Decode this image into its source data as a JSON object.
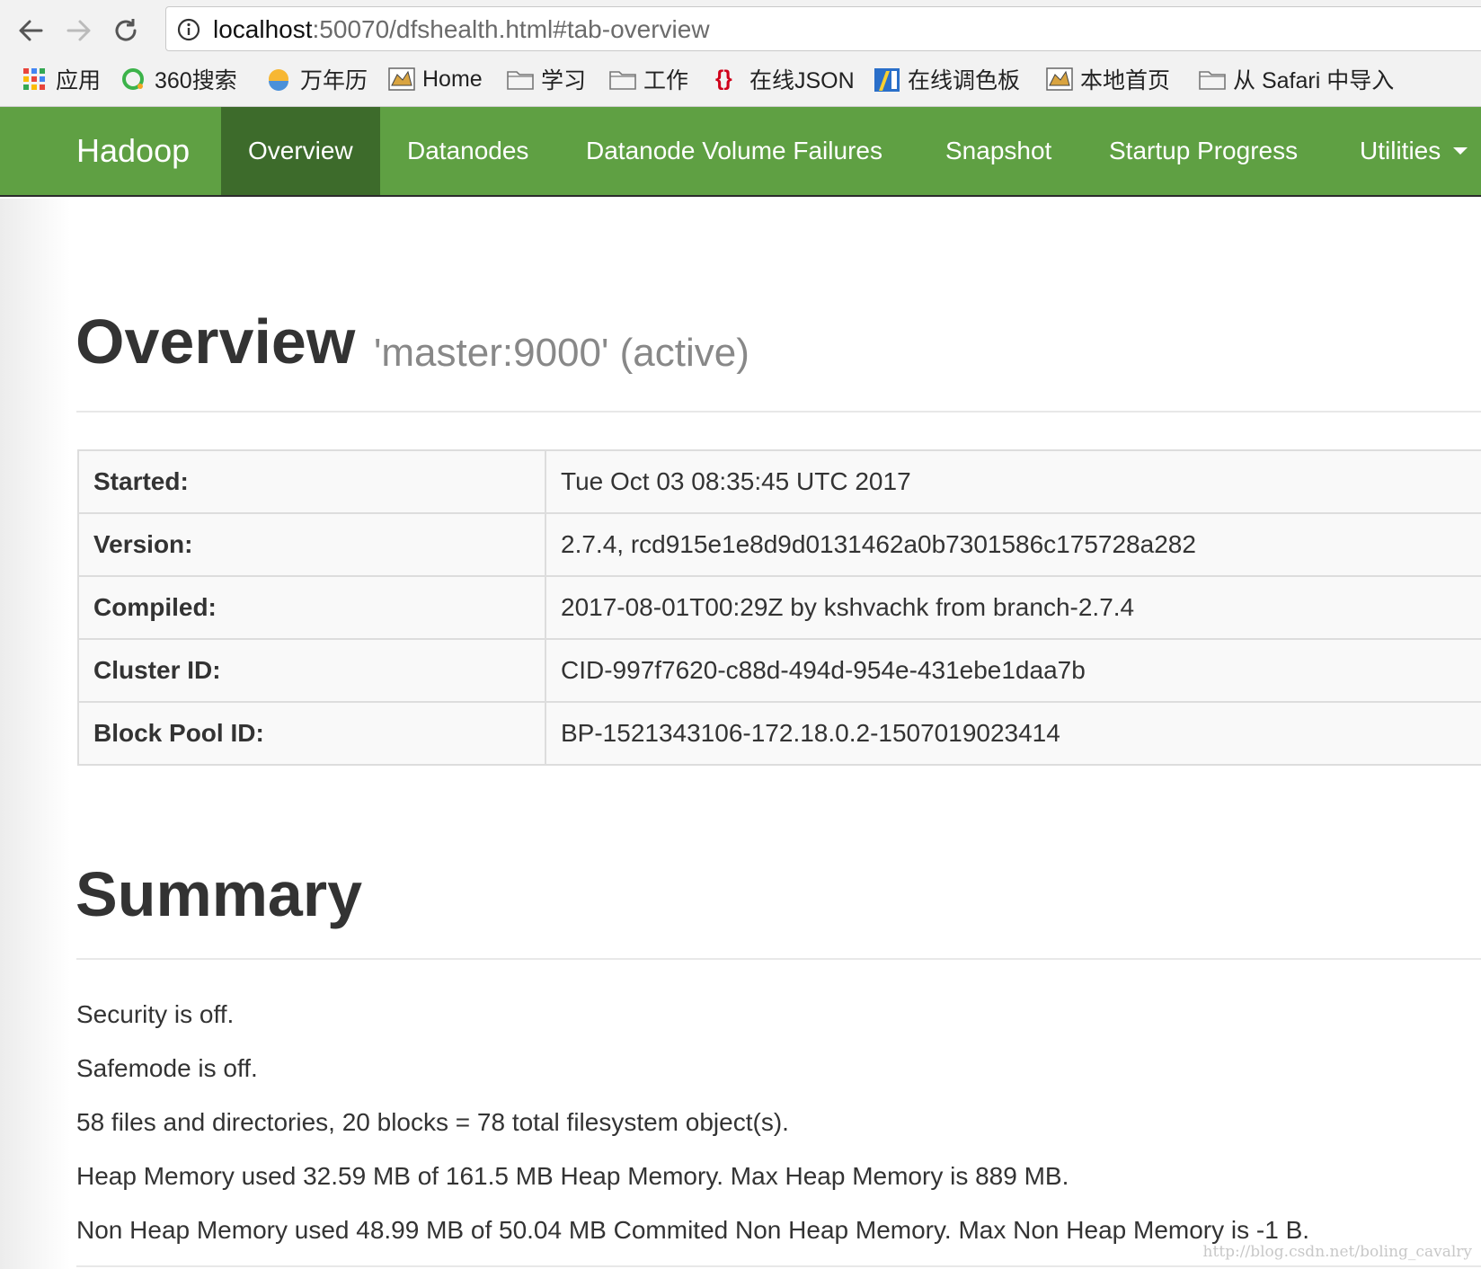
{
  "browser": {
    "url_host": "localhost",
    "url_path": ":50070/dfshealth.html#tab-overview",
    "bookmarks": [
      "应用",
      "360搜索",
      "万年历",
      "Home",
      "学习",
      "工作",
      "在线JSON",
      "在线调色板",
      "本地首页",
      "从 Safari 中导入"
    ]
  },
  "navbar": {
    "brand": "Hadoop",
    "items": [
      "Overview",
      "Datanodes",
      "Datanode Volume Failures",
      "Snapshot",
      "Startup Progress",
      "Utilities"
    ],
    "active": "Overview",
    "bg_color": "#5fa043",
    "active_color": "#3d6b2b"
  },
  "overview": {
    "title": "Overview",
    "subtitle": "'master:9000' (active)",
    "rows": [
      {
        "key": "Started:",
        "value": "Tue Oct 03 08:35:45 UTC 2017"
      },
      {
        "key": "Version:",
        "value": "2.7.4, rcd915e1e8d9d0131462a0b7301586c175728a282"
      },
      {
        "key": "Compiled:",
        "value": "2017-08-01T00:29Z by kshvachk from branch-2.7.4"
      },
      {
        "key": "Cluster ID:",
        "value": "CID-997f7620-c88d-494d-954e-431ebe1daa7b"
      },
      {
        "key": "Block Pool ID:",
        "value": "BP-1521343106-172.18.0.2-1507019023414"
      }
    ]
  },
  "summary": {
    "title": "Summary",
    "lines": [
      "Security is off.",
      "Safemode is off.",
      "58 files and directories, 20 blocks = 78 total filesystem object(s).",
      "Heap Memory used 32.59 MB of 161.5 MB Heap Memory. Max Heap Memory is 889 MB.",
      "Non Heap Memory used 48.99 MB of 50.04 MB Commited Non Heap Memory. Max Non Heap Memory is -1 B."
    ]
  },
  "watermark": "http://blog.csdn.net/boling_cavalry"
}
